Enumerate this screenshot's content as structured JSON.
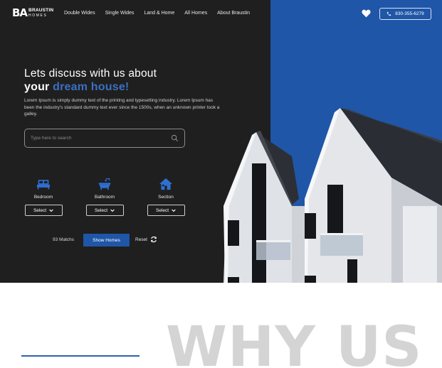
{
  "brand": {
    "mark": "BA",
    "name_top": "BRAUSTIN",
    "name_bottom": "HOMES"
  },
  "nav": [
    "Double Wides",
    "Single Wides",
    "Land & Home",
    "All Homes",
    "About Braustin"
  ],
  "header": {
    "phone": "830-355-6279",
    "favorites_icon": "heart-icon",
    "phone_icon": "phone-icon"
  },
  "hero": {
    "headline_line1": "Lets discuss with us about",
    "headline_line2_prefix": "your",
    "headline_line2_accent": "dream house!",
    "description": "Lorem Ipsum is simply dummy text of the printing and typesetting industry. Lorem Ipsum has been the industry's standard dummy text ever since the 1500s, when an unknown printer took a galley.",
    "search_placeholder": "Type here to search"
  },
  "filters": [
    {
      "label": "Bedroom",
      "icon": "bed-icon",
      "select": "Select"
    },
    {
      "label": "Bathroom",
      "icon": "bathtub-icon",
      "select": "Select"
    },
    {
      "label": "Section",
      "icon": "house-icon",
      "select": "Select"
    }
  ],
  "results": {
    "matches": "93 Matchs",
    "show_button": "Show Homes",
    "reset": "Reset"
  },
  "section": {
    "title": "WHY US"
  },
  "colors": {
    "accent": "#1f56a8",
    "dark": "#1f1f1f",
    "heading_gray": "#d4d4d4"
  }
}
